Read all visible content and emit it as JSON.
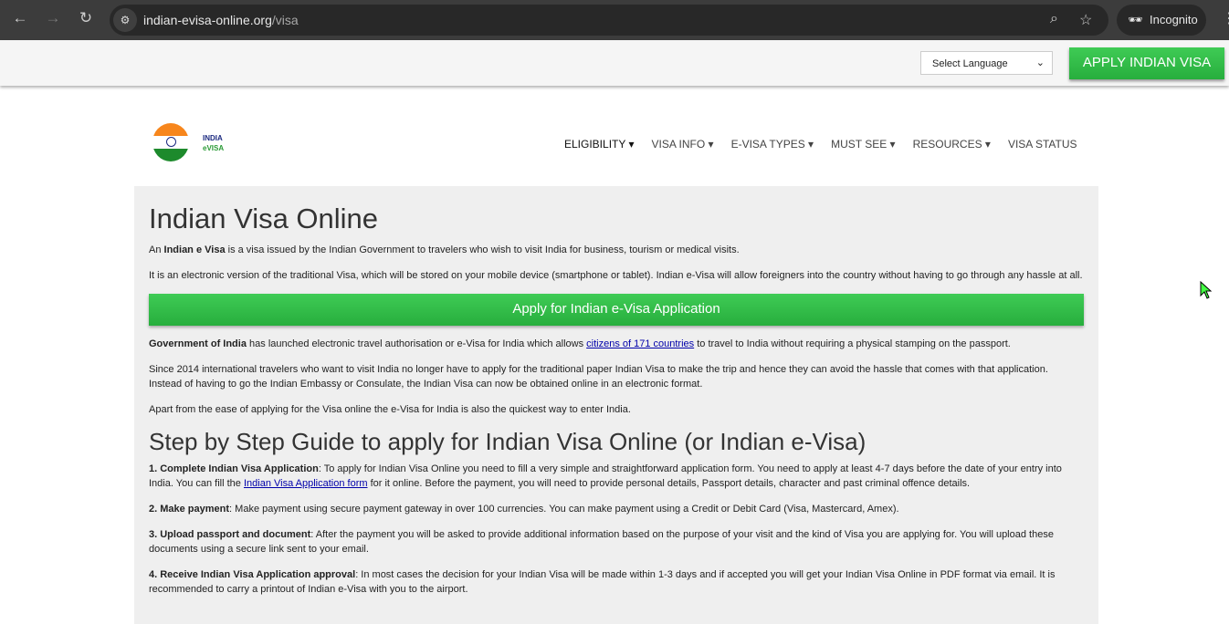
{
  "browser": {
    "url_host": "indian-evisa-online.org",
    "url_path": "/visa",
    "incognito": "Incognito"
  },
  "topbar": {
    "language": "Select Language",
    "apply": "APPLY INDIAN VISA"
  },
  "logo": {
    "line1": "INDIA",
    "line2": "eVISA"
  },
  "menu": [
    "ELIGIBILITY",
    "VISA INFO",
    "E-VISA TYPES",
    "MUST SEE",
    "RESOURCES",
    "VISA STATUS"
  ],
  "main": {
    "title": "Indian Visa Online",
    "p1_b": "Indian e Visa",
    "p1_a": "An ",
    "p1_c": " is a visa issued by the Indian Government to travelers who wish to visit India for business, tourism or medical visits.",
    "p2": "It is an electronic version of the traditional Visa, which will be stored on your mobile device (smartphone or tablet). Indian e-Visa will allow foreigners into the country without having to go through any hassle at all.",
    "apply_button": "Apply for Indian e-Visa Application",
    "p3_b": "Government of India",
    "p3_a": " has launched electronic travel authorisation or e-Visa for India which allows ",
    "p3_link": "citizens of 171 countries",
    "p3_c": " to travel to India without requiring a physical stamping on the passport.",
    "p4": "Since 2014 international travelers who want to visit India no longer have to apply for the traditional paper Indian Visa to make the trip and hence they can avoid the hassle that comes with that application. Instead of having to go the Indian Embassy or Consulate, the Indian Visa can now be obtained online in an electronic format.",
    "p5": "Apart from the ease of applying for the Visa online the e-Visa for India is also the quickest way to enter India.",
    "h2": "Step by Step Guide to apply for Indian Visa Online (or Indian e-Visa)",
    "s1_b": "1. Complete Indian Visa Application",
    "s1_a": ": To apply for Indian Visa Online you need to fill a very simple and straightforward application form. You need to apply at least 4-7 days before the date of your entry into India. You can fill the ",
    "s1_link": "Indian Visa Application form",
    "s1_c": " for it online. Before the payment, you will need to provide personal details, Passport details, character and past criminal offence details.",
    "s2_b": "2. Make payment",
    "s2_a": ": Make payment using secure payment gateway in over 100 currencies. You can make payment using a Credit or Debit Card (Visa, Mastercard, Amex).",
    "s3_b": "3. Upload passport and document",
    "s3_a": ": After the payment you will be asked to provide additional information based on the purpose of your visit and the kind of Visa you are applying for. You will upload these documents using a secure link sent to your email.",
    "s4_b": "4. Receive Indian Visa Application approval",
    "s4_a": ": In most cases the decision for your Indian Visa will be made within 1-3 days and if accepted you will get your Indian Visa Online in PDF format via email. It is recommended to carry a printout of Indian e-Visa with you to the airport."
  }
}
